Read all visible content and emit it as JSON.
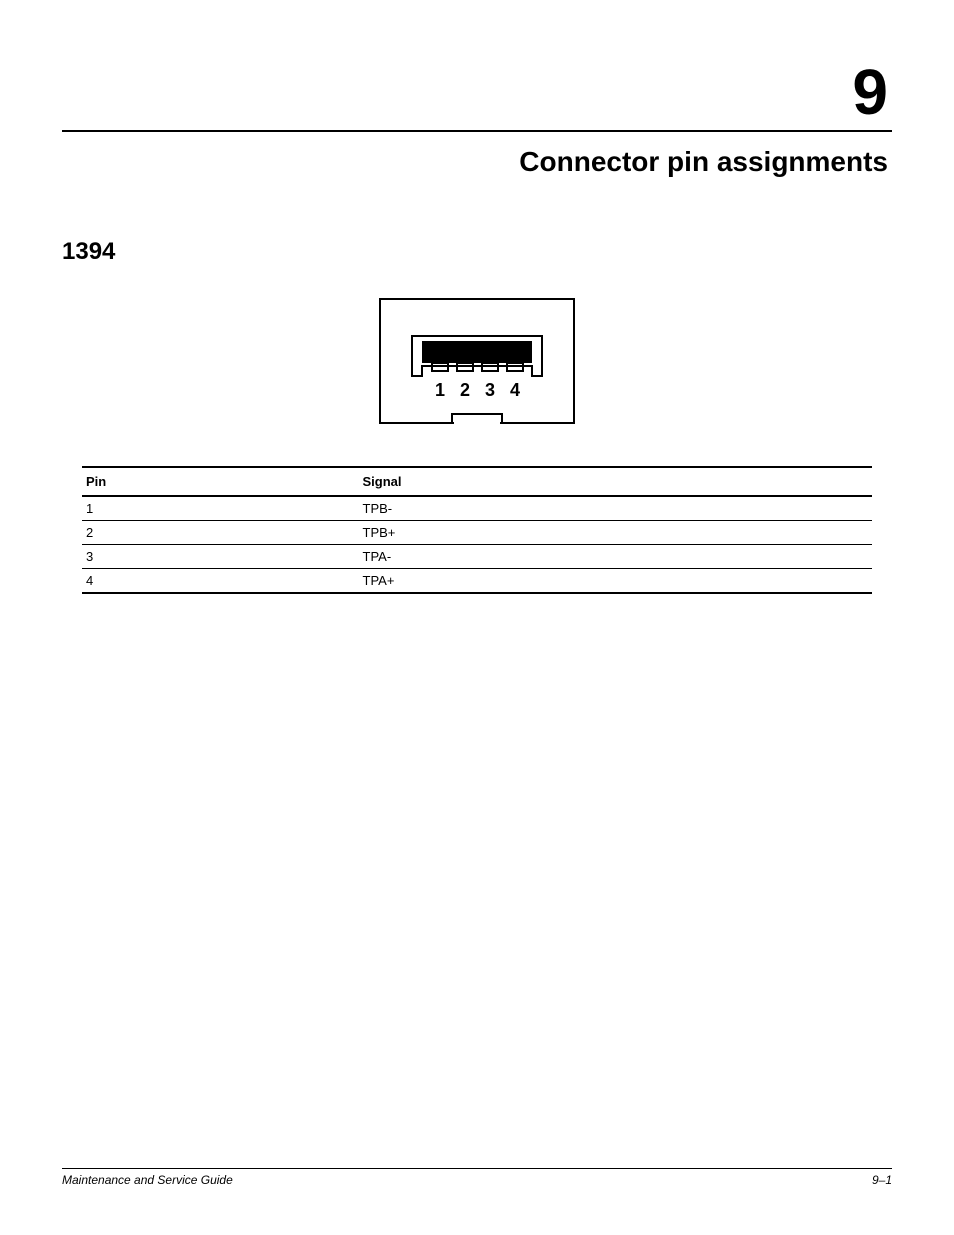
{
  "chapter": {
    "number": "9",
    "title": "Connector pin assignments"
  },
  "section": {
    "title": "1394"
  },
  "figure": {
    "pin_labels": [
      "1",
      "2",
      "3",
      "4"
    ]
  },
  "table": {
    "headers": {
      "pin": "Pin",
      "signal": "Signal"
    },
    "rows": [
      {
        "pin": "1",
        "signal": "TPB-"
      },
      {
        "pin": "2",
        "signal": "TPB+"
      },
      {
        "pin": "3",
        "signal": "TPA-"
      },
      {
        "pin": "4",
        "signal": "TPA+"
      }
    ]
  },
  "footer": {
    "left": "Maintenance and Service Guide",
    "right": "9–1"
  }
}
